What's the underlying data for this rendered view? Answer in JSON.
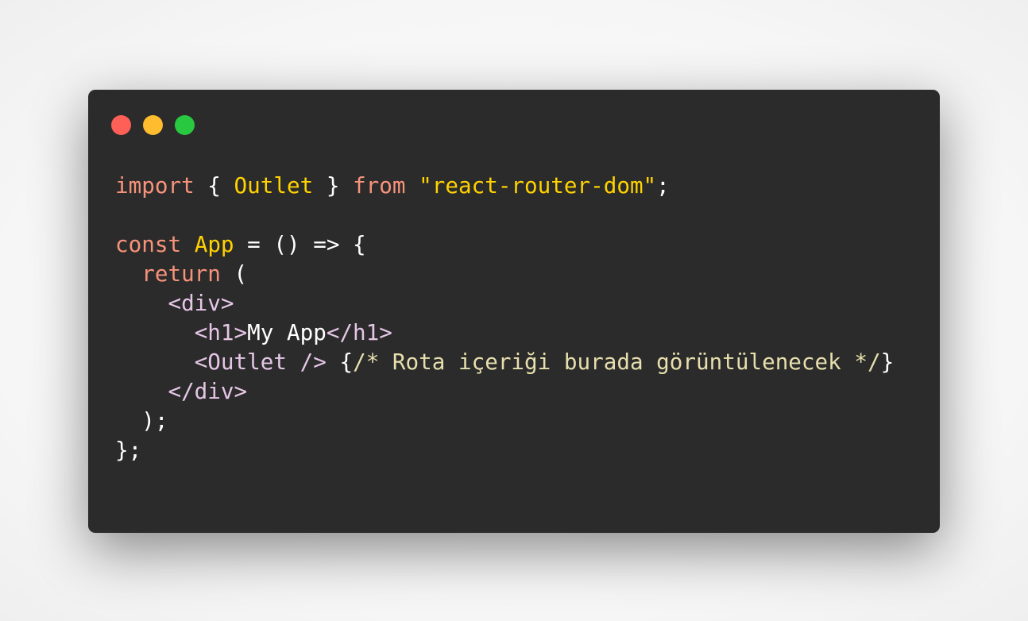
{
  "window": {
    "controls": {
      "close": "close",
      "minimize": "minimize",
      "maximize": "maximize"
    }
  },
  "code": {
    "line1": {
      "kw_import": "import",
      "brace_open": " { ",
      "name_outlet": "Outlet",
      "brace_close": " } ",
      "kw_from": "from",
      "space": " ",
      "str_module": "\"react-router-dom\"",
      "semicolon": ";"
    },
    "line3": {
      "kw_const": "const",
      "space": " ",
      "name_app": "App",
      "rest": " = () => {"
    },
    "line4": {
      "indent": "  ",
      "kw_return": "return",
      "rest": " ("
    },
    "line5": {
      "indent": "    ",
      "tag_div_open": "<div>"
    },
    "line6": {
      "indent": "      ",
      "tag_h1_open": "<h1>",
      "text": "My App",
      "tag_h1_close": "</h1>"
    },
    "line7": {
      "indent": "      ",
      "tag_outlet": "<Outlet />",
      "space": " ",
      "brace_open": "{",
      "comment": "/* Rota içeriği burada görüntülenecek */",
      "brace_close": "}"
    },
    "line8": {
      "indent": "    ",
      "tag_div_close": "</div>"
    },
    "line9": {
      "text": "  );"
    },
    "line10": {
      "text": "};"
    }
  },
  "colors": {
    "background": "#2b2b2b",
    "keyword": "#f8937b",
    "identifier": "#ffd200",
    "string": "#ffd200",
    "tag": "#e6c6e6",
    "comment": "#e7dfad",
    "plain": "#ffffff",
    "dot_red": "#fe5f57",
    "dot_yellow": "#febc2e",
    "dot_green": "#28c840"
  }
}
